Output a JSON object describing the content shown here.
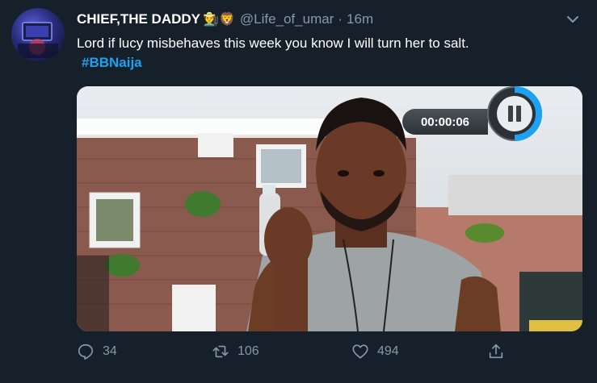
{
  "tweet": {
    "author_name": "CHIEF,THE DADDY",
    "author_emojis": "👨‍🌾🦁",
    "handle": "@Life_of_umar",
    "separator": "·",
    "time": "16m",
    "text": "Lord if lucy misbehaves this week you know I will turn her to salt.",
    "hashtag": "#BBNaija"
  },
  "video": {
    "timer": "00:00:06"
  },
  "actions": {
    "reply_count": "34",
    "retweet_count": "106",
    "like_count": "494"
  },
  "icons": [
    "chevron-down-icon",
    "pause-icon",
    "reply-icon",
    "retweet-icon",
    "like-icon",
    "share-icon"
  ],
  "colors": {
    "background": "#15202b",
    "secondary_text": "#8899a6",
    "link": "#1da1f2",
    "progress_ring": "#1da1f2"
  }
}
